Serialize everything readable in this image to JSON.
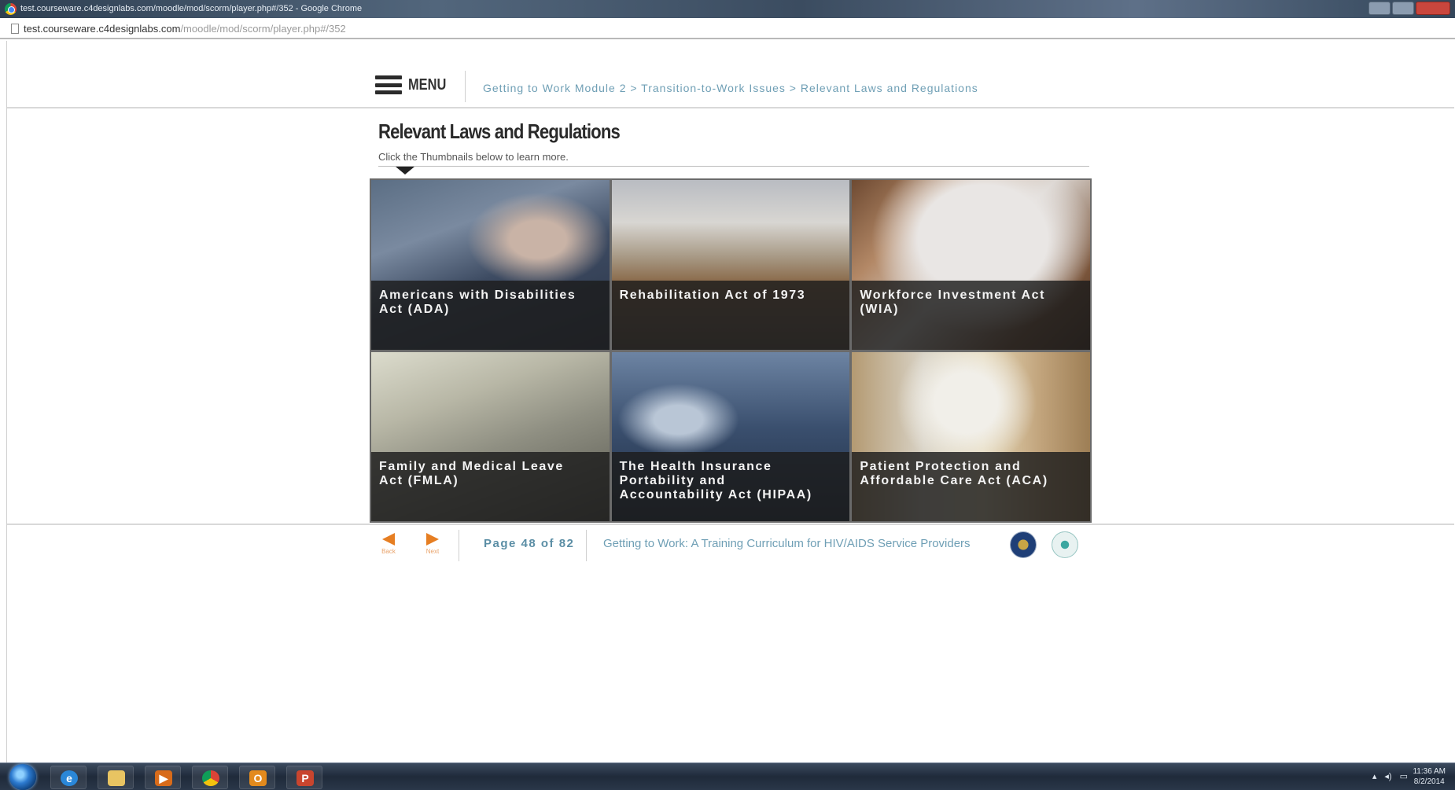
{
  "window": {
    "title": "test.courseware.c4designlabs.com/moodle/mod/scorm/player.php#/352 - Google Chrome"
  },
  "address_bar": {
    "host": "test.courseware.c4designlabs.com",
    "path": "/moodle/mod/scorm/player.php#/352"
  },
  "header": {
    "menu_label": "MENU",
    "breadcrumb": "Getting to Work Module 2 > Transition-to-Work Issues > Relevant Laws and Regulations"
  },
  "content": {
    "title": "Relevant Laws and Regulations",
    "instruction": "Click the Thumbnails below to learn more.",
    "tiles": [
      {
        "lines": [
          "Americans with Disabilities",
          "Act (ADA)"
        ]
      },
      {
        "lines": [
          "Rehabilitation Act of 1973"
        ]
      },
      {
        "lines": [
          "Workforce Investment Act",
          "(WIA)"
        ]
      },
      {
        "lines": [
          "Family and Medical Leave",
          "Act (FMLA)"
        ]
      },
      {
        "lines": [
          "The Health Insurance",
          "Portability and",
          "Accountability Act (HIPAA)"
        ]
      },
      {
        "lines": [
          "Patient Protection and",
          "Affordable Care Act (ACA)"
        ]
      }
    ]
  },
  "footer": {
    "back_label": "Back",
    "next_label": "Next",
    "page_indicator": "Page 48 of 82",
    "course_title": "Getting to Work: A Training Curriculum for HIV/AIDS Service Providers"
  },
  "taskbar": {
    "clock_time": "11:36 AM",
    "clock_date": "8/2/2014"
  },
  "colors": {
    "accent_orange": "#e67e22",
    "link_blue": "#6f9fb5"
  }
}
